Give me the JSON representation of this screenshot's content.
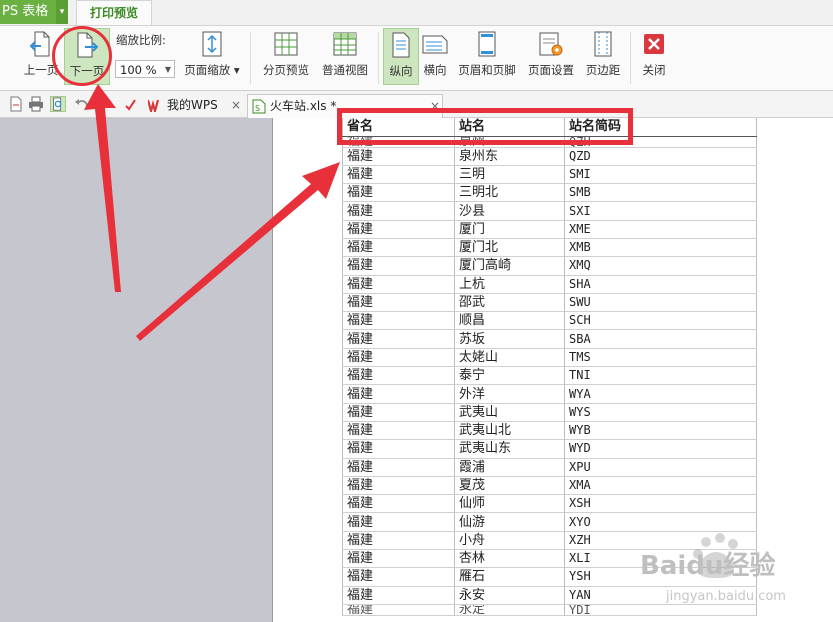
{
  "titlebar": {
    "app_name": "PS 表格",
    "app_menu_arrow": "▾",
    "active_tab": "打印预览"
  },
  "ribbon": {
    "prev_page": "上一页",
    "next_page": "下一页",
    "zoom_ratio_label": "缩放比例:",
    "zoom_value": "100 %",
    "page_zoom": "页面缩放",
    "page_break_preview": "分页预览",
    "normal_view": "普通视图",
    "portrait": "纵向",
    "landscape": "横向",
    "header_footer": "页眉和页脚",
    "page_setup": "页面设置",
    "margins": "页边距",
    "close": "关闭"
  },
  "tabs": [
    {
      "label": "我的WPS",
      "close": "×"
    },
    {
      "label": "火车站.xls *",
      "close": "×"
    }
  ],
  "sheet": {
    "headers": [
      "省名",
      "站名",
      "站名简码"
    ],
    "top_partial": [
      "福建",
      "泉州",
      "QZH"
    ],
    "rows": [
      [
        "福建",
        "泉州东",
        "QZD"
      ],
      [
        "福建",
        "三明",
        "SMI"
      ],
      [
        "福建",
        "三明北",
        "SMB"
      ],
      [
        "福建",
        "沙县",
        "SXI"
      ],
      [
        "福建",
        "厦门",
        "XME"
      ],
      [
        "福建",
        "厦门北",
        "XMB"
      ],
      [
        "福建",
        "厦门高崎",
        "XMQ"
      ],
      [
        "福建",
        "上杭",
        "SHA"
      ],
      [
        "福建",
        "邵武",
        "SWU"
      ],
      [
        "福建",
        "顺昌",
        "SCH"
      ],
      [
        "福建",
        "苏坂",
        "SBA"
      ],
      [
        "福建",
        "太姥山",
        "TMS"
      ],
      [
        "福建",
        "泰宁",
        "TNI"
      ],
      [
        "福建",
        "外洋",
        "WYA"
      ],
      [
        "福建",
        "武夷山",
        "WYS"
      ],
      [
        "福建",
        "武夷山北",
        "WYB"
      ],
      [
        "福建",
        "武夷山东",
        "WYD"
      ],
      [
        "福建",
        "霞浦",
        "XPU"
      ],
      [
        "福建",
        "夏茂",
        "XMA"
      ],
      [
        "福建",
        "仙师",
        "XSH"
      ],
      [
        "福建",
        "仙游",
        "XYO"
      ],
      [
        "福建",
        "小舟",
        "XZH"
      ],
      [
        "福建",
        "杏林",
        "XLI"
      ],
      [
        "福建",
        "雁石",
        "YSH"
      ],
      [
        "福建",
        "永安",
        "YAN"
      ]
    ],
    "bottom_partial": [
      "福建",
      "永定",
      "YDI"
    ]
  },
  "watermark": {
    "brand": "Baidu经验",
    "url": "jingyan.baidu.com"
  },
  "colors": {
    "accent_green": "#6ab043",
    "annotation_red": "#e8303a"
  }
}
